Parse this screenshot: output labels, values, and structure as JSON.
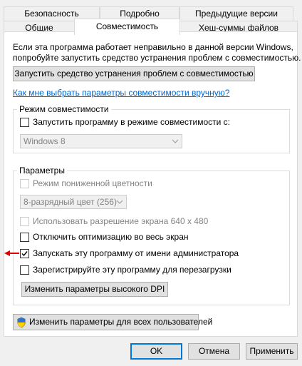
{
  "tabs": {
    "row1": [
      {
        "label": "Безопасность"
      },
      {
        "label": "Подробно"
      },
      {
        "label": "Предыдущие версии"
      }
    ],
    "row2": [
      {
        "label": "Общие"
      },
      {
        "label": "Совместимость"
      },
      {
        "label": "Хеш-суммы файлов"
      }
    ]
  },
  "intro": {
    "line1": "Если эта программа работает неправильно в данной версии Windows,",
    "line2": "попробуйте запустить средство устранения проблем с совместимостью."
  },
  "troubleshooter_button": "Запустить средство устранения проблем с совместимостью",
  "manual_link": "Как мне выбрать параметры совместимости вручную?",
  "compat_mode": {
    "title": "Режим совместимости",
    "checkbox_label": "Запустить программу в режиме совместимости с:",
    "checked": false,
    "os_selected": "Windows 8"
  },
  "settings": {
    "title": "Параметры",
    "reduced_color": {
      "label": "Режим пониженной цветности",
      "checked": false,
      "enabled": false
    },
    "color_selected": "8-разрядный цвет (256)",
    "res_640": {
      "label": "Использовать разрешение экрана 640 x 480",
      "checked": false,
      "enabled": false
    },
    "disable_fullscreen": {
      "label": "Отключить оптимизацию во весь экран",
      "checked": false
    },
    "run_as_admin": {
      "label": "Запускать эту программу от имени администратора",
      "checked": true
    },
    "register_restart": {
      "label": "Зарегистрируйте эту программу для перезагрузки",
      "checked": false
    },
    "dpi_button": "Изменить параметры высокого DPI"
  },
  "all_users_button": "Изменить параметры для всех пользователей",
  "footer": {
    "ok": "OK",
    "cancel": "Отмена",
    "apply": "Применить"
  },
  "colors": {
    "accent": "#0078d7",
    "link": "#0066cc",
    "arrow": "#e00000"
  }
}
